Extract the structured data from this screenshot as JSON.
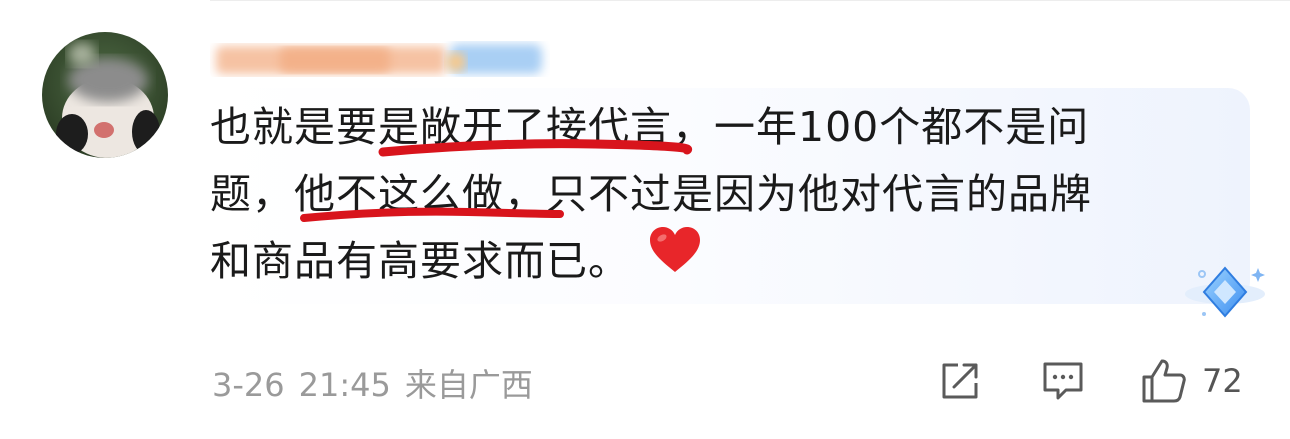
{
  "comment": {
    "line1": "也就是要是敞开了接代言，一年100个都不是问",
    "line2": "题，他不这么做，只不过是因为他对代言的品牌",
    "line3": "和商品有高要求而已。",
    "emoji": "heart-emoji"
  },
  "meta": {
    "date": "3-26",
    "time": "21:45",
    "location": "来自广西"
  },
  "actions": {
    "like_count": "72"
  },
  "colors": {
    "underline": "#d8141c",
    "meta_text": "#9a9a9a",
    "heart": "#e8262a"
  }
}
